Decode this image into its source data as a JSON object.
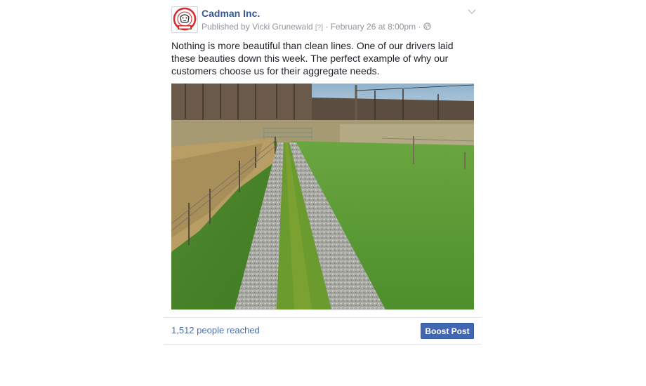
{
  "post": {
    "page_name": "Cadman Inc.",
    "published_by_prefix": "Published by",
    "author": "Vicki Grunewald",
    "help_marker": "[?]",
    "separator": "·",
    "timestamp": "February 26 at 8:00pm",
    "audience_icon": "globe-icon",
    "menu_icon": "chevron-down-icon",
    "message": "Nothing is more beautiful than clean lines. One of our drivers laid these beauties down this week. The perfect example of why our customers choose us for their aggregate needs.",
    "image_alt": "Gravel driveway with two gravel tracks through a green lawn"
  },
  "footer": {
    "reach": "1,512 people reached",
    "boost_label": "Boost Post"
  },
  "colors": {
    "link": "#365899",
    "boost_button": "#4267b2",
    "meta_text": "#90949c"
  }
}
